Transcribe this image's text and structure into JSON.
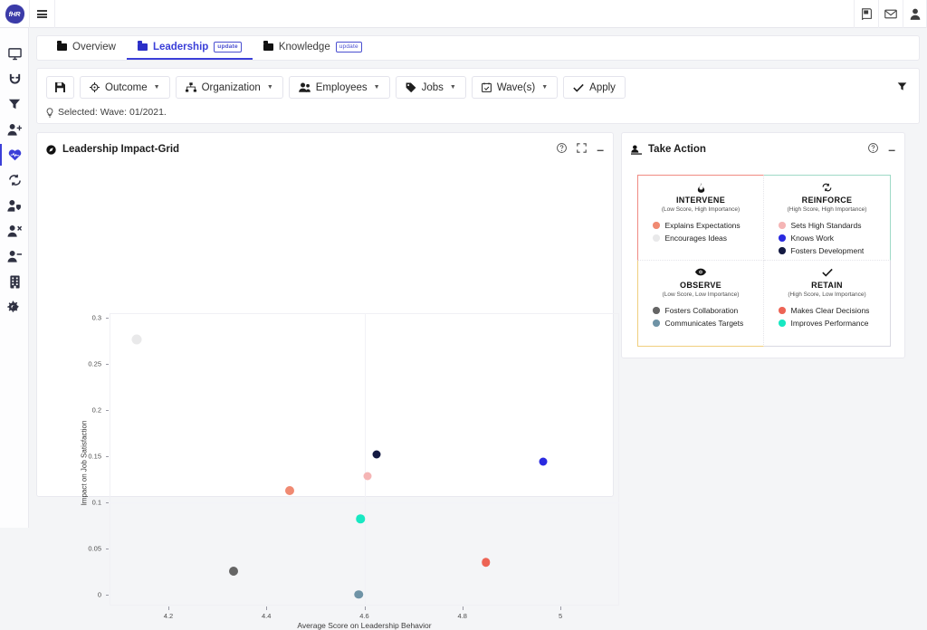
{
  "app": {
    "logo_text": "fHR"
  },
  "topbar": {
    "menu_icon": "hamburger-icon",
    "right_icons": [
      {
        "name": "book-icon",
        "label": "Documentation"
      },
      {
        "name": "envelope-icon",
        "label": "Messages"
      },
      {
        "name": "user-icon",
        "label": "Account"
      }
    ]
  },
  "sidebar": {
    "items": [
      {
        "name": "monitor-icon",
        "label": "Dashboard",
        "active": false
      },
      {
        "name": "magnet-icon",
        "label": "Attraction",
        "active": false
      },
      {
        "name": "funnel-icon",
        "label": "Funnel",
        "active": false
      },
      {
        "name": "user-plus-icon",
        "label": "Onboarding",
        "active": false
      },
      {
        "name": "heart-icon",
        "label": "Engagement",
        "active": true
      },
      {
        "name": "refresh-icon",
        "label": "Retention",
        "active": false
      },
      {
        "name": "user-shield-icon",
        "label": "Compliance",
        "active": false
      },
      {
        "name": "user-times-icon",
        "label": "Exits",
        "active": false
      },
      {
        "name": "user-minus-icon",
        "label": "Reductions",
        "active": false
      },
      {
        "name": "building-icon",
        "label": "Organization",
        "active": false
      },
      {
        "name": "cogs-icon",
        "label": "Settings",
        "active": false
      }
    ]
  },
  "tabs": [
    {
      "label": "Overview",
      "active": false,
      "badge": ""
    },
    {
      "label": "Leadership",
      "active": true,
      "badge": "update"
    },
    {
      "label": "Knowledge",
      "active": false,
      "badge": "update"
    }
  ],
  "toolbar": {
    "save_label": "",
    "buttons": [
      {
        "icon": "save-icon",
        "label": "",
        "caret": false
      },
      {
        "icon": "target-icon",
        "label": "Outcome",
        "caret": true
      },
      {
        "icon": "sitemap-icon",
        "label": "Organization",
        "caret": true
      },
      {
        "icon": "users-icon",
        "label": "Employees",
        "caret": true
      },
      {
        "icon": "tag-icon",
        "label": "Jobs",
        "caret": true
      },
      {
        "icon": "calendar-check-icon",
        "label": "Wave(s)",
        "caret": true
      },
      {
        "icon": "check-icon",
        "label": "Apply",
        "caret": false
      }
    ],
    "filter_icon": "filter-icon",
    "selected_text": "Selected: Wave: 01/2021."
  },
  "chart_panel": {
    "title": "Leadership Impact-Grid",
    "title_icon": "compass-icon",
    "actions": [
      {
        "name": "help-icon",
        "label": "?"
      },
      {
        "name": "expand-icon",
        "label": "Expand"
      },
      {
        "name": "minimize-icon",
        "label": "–"
      }
    ]
  },
  "action_panel": {
    "title": "Take Action",
    "title_icon": "person-action-icon",
    "actions": [
      {
        "name": "help-icon",
        "label": "?"
      },
      {
        "name": "minimize-icon",
        "label": "–"
      }
    ],
    "quadrants": [
      {
        "key": "intervene",
        "icon": "flame-icon",
        "title": "INTERVENE",
        "subtitle": "(Low Score, High Importance)",
        "border_color": "#f08a82",
        "items": [
          {
            "label": "Explains Expectations",
            "color": "#f08a72"
          },
          {
            "label": "Encourages Ideas",
            "color": "#e9e9ea"
          }
        ]
      },
      {
        "key": "reinforce",
        "icon": "sync-icon",
        "title": "REINFORCE",
        "subtitle": "(High Score, High Importance)",
        "border_color": "#9fd9c6",
        "items": [
          {
            "label": "Sets High Standards",
            "color": "#f5b5b5"
          },
          {
            "label": "Knows Work",
            "color": "#2a2ae0"
          },
          {
            "label": "Fosters Development",
            "color": "#141a42"
          }
        ]
      },
      {
        "key": "observe",
        "icon": "eye-icon",
        "title": "OBSERVE",
        "subtitle": "(Low Score, Low Importance)",
        "border_color": "#f0cf7e",
        "items": [
          {
            "label": "Fosters Collaboration",
            "color": "#656565"
          },
          {
            "label": "Communicates Targets",
            "color": "#6f93a6"
          }
        ]
      },
      {
        "key": "retain",
        "icon": "check-mark-icon",
        "title": "RETAIN",
        "subtitle": "(High Score, Low Importance)",
        "border_color": "#d9d9e2",
        "items": [
          {
            "label": "Makes Clear Decisions",
            "color": "#ed6455"
          },
          {
            "label": "Improves Performance",
            "color": "#18e8c2"
          }
        ]
      }
    ]
  },
  "chart_data": {
    "type": "scatter",
    "title": "Leadership Impact-Grid",
    "xlabel": "Average Score on Leadership Behavior",
    "ylabel": "Impact on Job Satisfaction",
    "xlim": [
      4.08,
      5.12
    ],
    "ylim": [
      -0.012,
      0.305
    ],
    "xticks": [
      4.2,
      4.4,
      4.6,
      4.8,
      5
    ],
    "xtick_labels": [
      "4.2",
      "4.4",
      "4.6",
      "4.8",
      "5"
    ],
    "yticks": [
      0,
      0.05,
      0.1,
      0.15,
      0.2,
      0.25,
      0.3
    ],
    "ytick_labels": [
      "0",
      "0.05",
      "0.1",
      "0.15",
      "0.2",
      "0.25",
      "0.3"
    ],
    "grid": false,
    "quadrant_lines": {
      "x": 4.6,
      "y": 0.1
    },
    "legend_position": "external-take-action-panel",
    "points": [
      {
        "label": "Encourages Ideas",
        "x": 4.135,
        "y": 0.277,
        "color": "#e9e9ea",
        "size": 11
      },
      {
        "label": "Fosters Development",
        "x": 4.625,
        "y": 0.152,
        "color": "#141a42",
        "size": 9
      },
      {
        "label": "Knows Work",
        "x": 4.965,
        "y": 0.144,
        "color": "#2a2ae0",
        "size": 9
      },
      {
        "label": "Sets High Standards",
        "x": 4.607,
        "y": 0.128,
        "color": "#f5b5b5",
        "size": 9
      },
      {
        "label": "Explains Expectations",
        "x": 4.447,
        "y": 0.113,
        "color": "#f08a72",
        "size": 10
      },
      {
        "label": "Improves Performance",
        "x": 4.592,
        "y": 0.082,
        "color": "#18e8c2",
        "size": 9.5
      },
      {
        "label": "Makes Clear Decisions",
        "x": 4.848,
        "y": 0.035,
        "color": "#ed6455",
        "size": 9.5
      },
      {
        "label": "Fosters Collaboration",
        "x": 4.333,
        "y": 0.025,
        "color": "#656565",
        "size": 10
      },
      {
        "label": "Communicates Targets",
        "x": 4.588,
        "y": 0.0,
        "color": "#6f93a6",
        "size": 9.5
      }
    ]
  }
}
